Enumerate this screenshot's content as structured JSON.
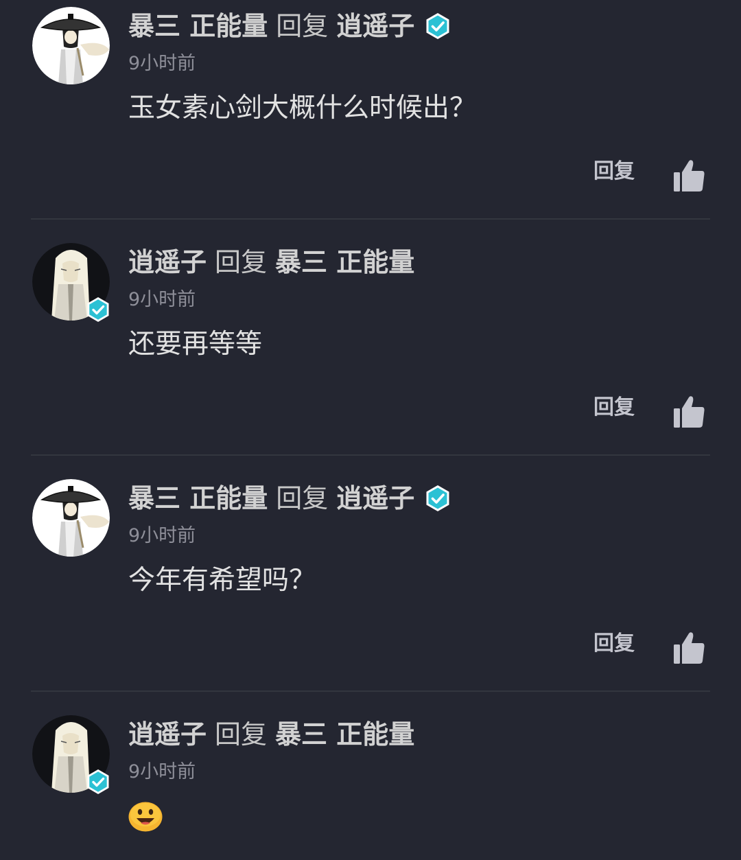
{
  "colors": {
    "background": "#242631",
    "name_text": "#d2d2d2",
    "time_text": "#8e8f99",
    "verified_badge": "#2cc1d4",
    "action_text": "#c4c5ce"
  },
  "comments": [
    {
      "author": "暴三 正能量",
      "reply_word": "回复",
      "reply_to": "逍遥子",
      "time": "9小时前",
      "text": "玉女素心剑大概什么时候出？",
      "reply_label": "回复",
      "like_icon": "thumbs-up-icon"
    },
    {
      "author": "逍遥子",
      "reply_word": "回复",
      "reply_to": "暴三 正能量",
      "time": "9小时前",
      "text": "还要再等等",
      "reply_label": "回复",
      "like_icon": "thumbs-up-icon"
    },
    {
      "author": "暴三 正能量",
      "reply_word": "回复",
      "reply_to": "逍遥子",
      "time": "9小时前",
      "text": "今年有希望吗？",
      "reply_label": "回复",
      "like_icon": "thumbs-up-icon"
    },
    {
      "author": "逍遥子",
      "reply_word": "回复",
      "reply_to": "暴三 正能量",
      "time": "9小时前",
      "emoji": "smiling-face-emoji"
    }
  ]
}
